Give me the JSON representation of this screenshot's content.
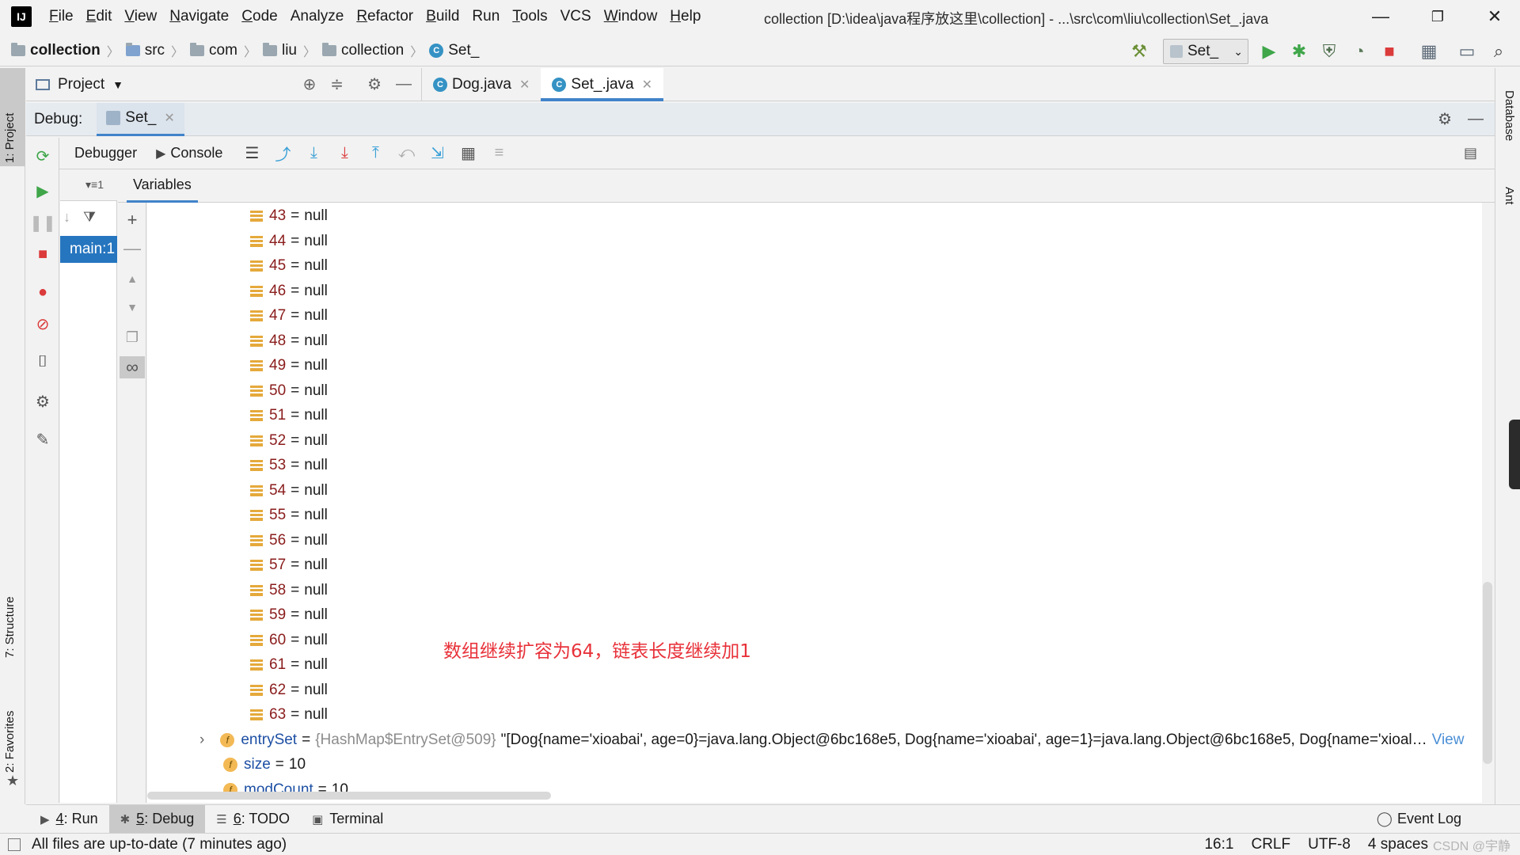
{
  "menubar": {
    "items": [
      {
        "u": "F",
        "rest": "ile"
      },
      {
        "u": "E",
        "rest": "dit"
      },
      {
        "u": "V",
        "rest": "iew"
      },
      {
        "u": "N",
        "rest": "avigate"
      },
      {
        "u": "C",
        "rest": "ode"
      },
      {
        "u": "",
        "rest": "Analyze"
      },
      {
        "u": "R",
        "rest": "efactor"
      },
      {
        "u": "B",
        "rest": "uild"
      },
      {
        "u": "",
        "rest": "Run"
      },
      {
        "u": "T",
        "rest": "ools"
      },
      {
        "u": "",
        "rest": "VCS"
      },
      {
        "u": "W",
        "rest": "indow"
      },
      {
        "u": "H",
        "rest": "elp"
      }
    ],
    "window_title": "collection [D:\\idea\\java程序放这里\\collection] - ...\\src\\com\\liu\\collection\\Set_.java"
  },
  "navbar": {
    "crumbs": [
      "collection",
      "src",
      "com",
      "liu",
      "collection",
      "Set_"
    ],
    "run_config": "Set_"
  },
  "left_stripe": {
    "project": "1: Project",
    "structure": "7: Structure",
    "favorites": "2: Favorites"
  },
  "right_stripe": {
    "database": "Database",
    "ant": "Ant"
  },
  "tabrow": {
    "project_label": "Project",
    "tabs": [
      {
        "label": "Dog.java"
      },
      {
        "label": "Set_.java"
      }
    ]
  },
  "debug": {
    "label": "Debug:",
    "session_tab": "Set_",
    "debugger_tab": "Debugger",
    "console_tab": "Console",
    "variables_tab": "Variables",
    "frame": "main:1"
  },
  "variables": {
    "null_rows": [
      {
        "key": "43",
        "value": "null"
      },
      {
        "key": "44",
        "value": "null"
      },
      {
        "key": "45",
        "value": "null"
      },
      {
        "key": "46",
        "value": "null"
      },
      {
        "key": "47",
        "value": "null"
      },
      {
        "key": "48",
        "value": "null"
      },
      {
        "key": "49",
        "value": "null"
      },
      {
        "key": "50",
        "value": "null"
      },
      {
        "key": "51",
        "value": "null"
      },
      {
        "key": "52",
        "value": "null"
      },
      {
        "key": "53",
        "value": "null"
      },
      {
        "key": "54",
        "value": "null"
      },
      {
        "key": "55",
        "value": "null"
      },
      {
        "key": "56",
        "value": "null"
      },
      {
        "key": "57",
        "value": "null"
      },
      {
        "key": "58",
        "value": "null"
      },
      {
        "key": "59",
        "value": "null"
      },
      {
        "key": "60",
        "value": "null"
      },
      {
        "key": "61",
        "value": "null"
      },
      {
        "key": "62",
        "value": "null"
      },
      {
        "key": "63",
        "value": "null"
      }
    ],
    "entry_set": {
      "name": "entrySet",
      "type": "{HashMap$EntrySet@509}",
      "value": "\"[Dog{name='xioabai', age=0}=java.lang.Object@6bc168e5, Dog{name='xioabai', age=1}=java.lang.Object@6bc168e5, Dog{name='xioal…",
      "view": "View"
    },
    "size": {
      "name": "size",
      "value": "10"
    },
    "mod_count": {
      "name": "modCount",
      "value": "10"
    },
    "annotation": "数组继续扩容为64，链表长度继续加1"
  },
  "bottom_tabs": [
    {
      "num": "4",
      "label": ": Run"
    },
    {
      "num": "5",
      "label": ": Debug"
    },
    {
      "num": "6",
      "label": ": TODO"
    },
    {
      "num": "",
      "label": "Terminal"
    }
  ],
  "event_log": "Event Log",
  "status": {
    "message": "All files are up-to-date (7 minutes ago)",
    "position": "16:1",
    "line_sep": "CRLF",
    "encoding": "UTF-8",
    "indent": "4 spaces",
    "watermark": "CSDN @宇静"
  }
}
